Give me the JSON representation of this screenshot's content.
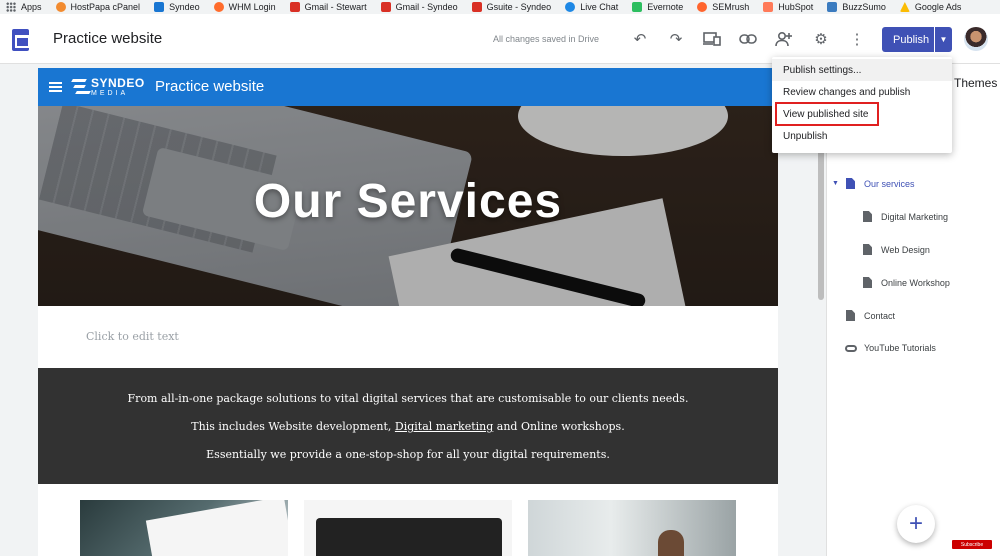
{
  "bookmarks": [
    {
      "label": "Apps",
      "icon": "apps-grid-icon",
      "color": "#5f6368"
    },
    {
      "label": "HostPapa cPanel",
      "icon": "hostpapa-icon",
      "color": "#f28b30"
    },
    {
      "label": "Syndeo",
      "icon": "syndeo-icon",
      "color": "#1976d2"
    },
    {
      "label": "WHM Login",
      "icon": "cpanel-icon",
      "color": "#ff6c2c"
    },
    {
      "label": "Gmail - Stewart",
      "icon": "gmail-icon",
      "color": "#d93025"
    },
    {
      "label": "Gmail - Syndeo",
      "icon": "gmail-icon",
      "color": "#d93025"
    },
    {
      "label": "Gsuite - Syndeo",
      "icon": "gmail-icon",
      "color": "#d93025"
    },
    {
      "label": "Live Chat",
      "icon": "live-chat-icon",
      "color": "#1e88e5"
    },
    {
      "label": "Evernote",
      "icon": "evernote-icon",
      "color": "#2dbe60"
    },
    {
      "label": "SEMrush",
      "icon": "semrush-icon",
      "color": "#ff642d"
    },
    {
      "label": "HubSpot",
      "icon": "hubspot-icon",
      "color": "#ff7a59"
    },
    {
      "label": "BuzzSumo",
      "icon": "buzzsumo-icon",
      "color": "#3b7bbf"
    },
    {
      "label": "Google Ads",
      "icon": "google-ads-icon",
      "color": "#fbbc04"
    }
  ],
  "appbar": {
    "title": "Practice website",
    "save_status": "All changes saved in Drive",
    "publish_label": "Publish",
    "accent": "#3f51b5"
  },
  "site": {
    "logo_line1": "SYNDEO",
    "logo_line2": "MEDIA",
    "title": "Practice website",
    "header_color": "#1976d2",
    "hero_title": "Our Services",
    "edit_placeholder": "Click to edit text",
    "band_line1": "From all-in-one package solutions to vital digital services that are customisable to our clients needs.",
    "band_line2_pre": "This includes Website development, ",
    "band_line2_link": "Digital marketing",
    "band_line2_post": " and Online workshops.",
    "band_line3": "Essentially we provide a one-stop-shop for all your digital requirements."
  },
  "panel": {
    "themes_tab": "Themes",
    "pages": [
      {
        "label": "Our services",
        "level": 0,
        "active": true
      },
      {
        "label": "Digital Marketing",
        "level": 1,
        "active": false
      },
      {
        "label": "Web Design",
        "level": 1,
        "active": false
      },
      {
        "label": "Online Workshop",
        "level": 1,
        "active": false
      },
      {
        "label": "Contact",
        "level": 0,
        "active": false
      },
      {
        "label": "YouTube Tutorials",
        "level": 0,
        "active": false,
        "type": "link"
      }
    ]
  },
  "publish_menu": {
    "items": [
      "Publish settings...",
      "Review changes and publish",
      "View published site",
      "Unpublish"
    ],
    "highlighted_item": "View published site",
    "highlight_color": "#e02020"
  },
  "fab_label": "+",
  "subscribe_label": "Subscribe"
}
